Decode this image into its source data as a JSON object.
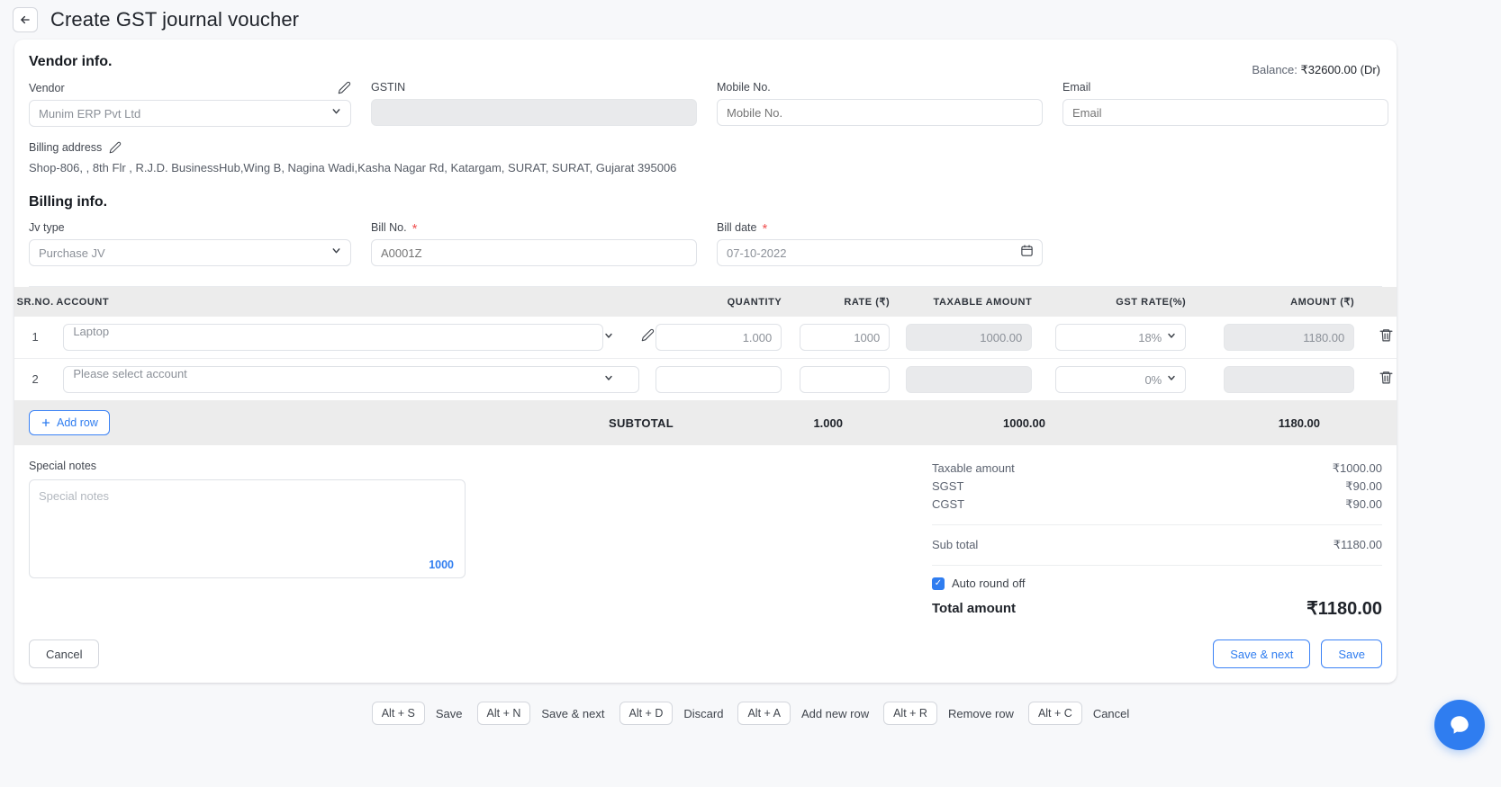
{
  "header": {
    "back_icon": "arrow-left-icon",
    "title": "Create GST journal voucher"
  },
  "vendor_info": {
    "section_title": "Vendor info.",
    "balance_prefix": "Balance: ",
    "balance_value": "₹32600.00 (Dr)",
    "vendor": {
      "label": "Vendor",
      "value": "Munim ERP Pvt Ltd",
      "edit_icon": "pencil-icon",
      "chevron_icon": "chevron-down-icon"
    },
    "gstin": {
      "label": "GSTIN",
      "value": ""
    },
    "mobile": {
      "label": "Mobile No.",
      "placeholder": "Mobile No.",
      "value": ""
    },
    "email": {
      "label": "Email",
      "placeholder": "Email",
      "value": ""
    },
    "billing_address": {
      "label": "Billing address",
      "edit_icon": "pencil-icon",
      "text": "Shop-806, , 8th Flr , R.J.D. BusinessHub,Wing B, Nagina Wadi,Kasha Nagar Rd, Katargam, SURAT, SURAT, Gujarat 395006"
    }
  },
  "billing_info": {
    "section_title": "Billing info.",
    "jv_type": {
      "label": "Jv type",
      "value": "Purchase JV",
      "chevron_icon": "chevron-down-icon"
    },
    "bill_no": {
      "label": "Bill No.",
      "required_mark": "*",
      "placeholder": "A0001Z",
      "value": ""
    },
    "bill_date": {
      "label": "Bill date",
      "required_mark": "*",
      "value": "07-10-2022",
      "calendar_icon": "calendar-icon"
    }
  },
  "line_table": {
    "columns": [
      "SR.NO.",
      "ACCOUNT",
      "QUANTITY",
      "RATE (₹)",
      "TAXABLE AMOUNT",
      "GST RATE(%)",
      "AMOUNT (₹)"
    ],
    "rows": [
      {
        "sr": "1",
        "account": "Laptop",
        "account_placeholder": "Please select account",
        "edit_icon": "pencil-icon",
        "quantity": "1.000",
        "rate": "1000",
        "taxable_amount": "1000.00",
        "gst_rate": "18%",
        "amount": "1180.00",
        "delete_icon": "trash-icon"
      },
      {
        "sr": "2",
        "account": "",
        "account_placeholder": "Please select account",
        "quantity": "",
        "rate": "",
        "taxable_amount": "",
        "gst_rate": "0%",
        "amount": "",
        "delete_icon": "trash-icon"
      }
    ],
    "add_row_label": "Add row",
    "add_row_icon": "plus-icon",
    "subtotal_label": "SUBTOTAL",
    "subtotal_quantity": "1.000",
    "subtotal_taxable": "1000.00",
    "subtotal_amount": "1180.00"
  },
  "notes": {
    "label": "Special notes",
    "placeholder": "Special notes",
    "value": "",
    "char_limit": "1000"
  },
  "totals": {
    "rows": [
      {
        "label": "Taxable amount",
        "value": "₹1000.00"
      },
      {
        "label": "SGST",
        "value": "₹90.00"
      },
      {
        "label": "CGST",
        "value": "₹90.00"
      }
    ],
    "sub_total_label": "Sub total",
    "sub_total_value": "₹1180.00",
    "auto_round_label": "Auto round off",
    "auto_round_checked": true,
    "total_label": "Total amount",
    "total_value": "₹1180.00"
  },
  "actions": {
    "cancel": "Cancel",
    "save_next": "Save & next",
    "save": "Save"
  },
  "shortcuts": [
    {
      "key": "Alt + S",
      "label": "Save"
    },
    {
      "key": "Alt + N",
      "label": "Save & next"
    },
    {
      "key": "Alt + D",
      "label": "Discard"
    },
    {
      "key": "Alt + A",
      "label": "Add new row"
    },
    {
      "key": "Alt + R",
      "label": "Remove row"
    },
    {
      "key": "Alt + C",
      "label": "Cancel"
    }
  ],
  "chat": {
    "icon": "chat-bubble-icon"
  },
  "colors": {
    "accent": "#2f7df0",
    "required": "#f05252",
    "header_bg": "#ececec"
  }
}
